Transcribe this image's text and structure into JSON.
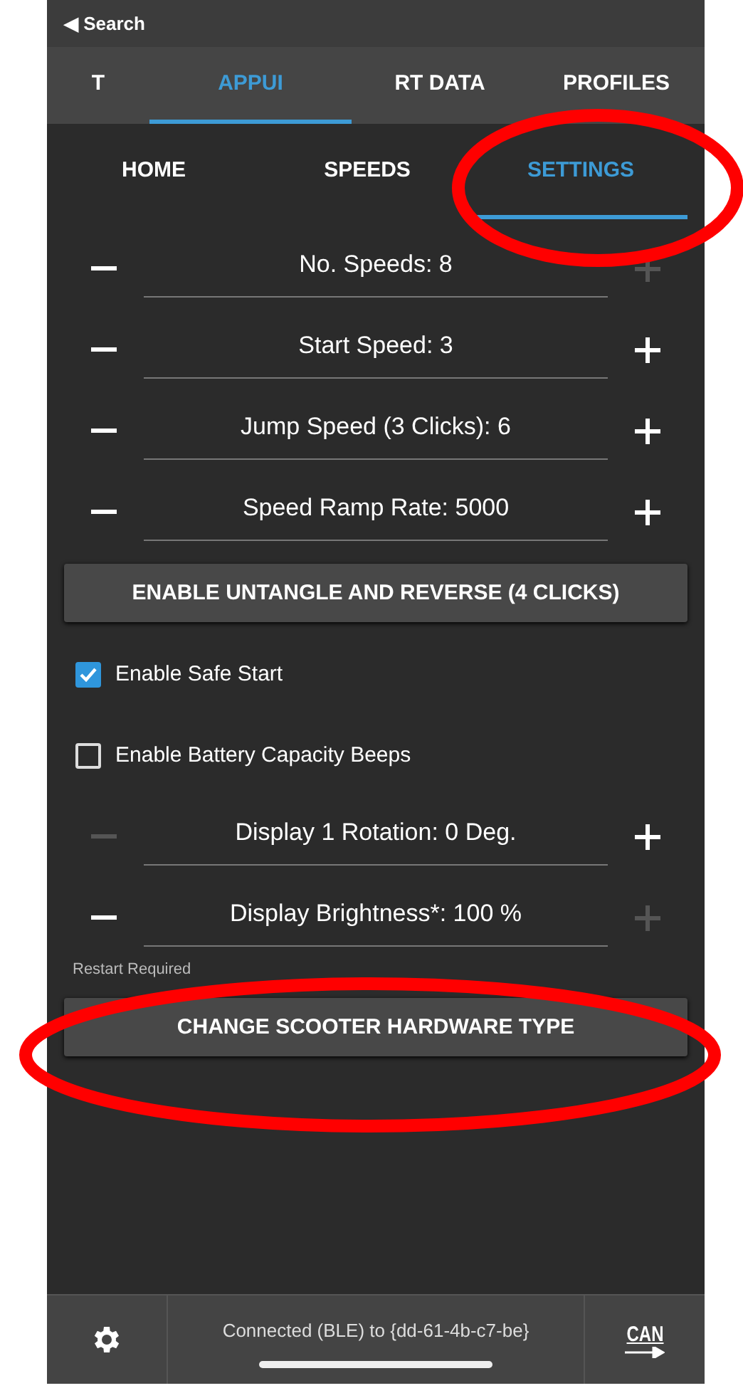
{
  "status_bar": {
    "back": "◀ Search"
  },
  "tabs": [
    {
      "label": "T",
      "selected": false
    },
    {
      "label": "APPUI",
      "selected": true
    },
    {
      "label": "RT DATA",
      "selected": false
    },
    {
      "label": "PROFILES",
      "selected": false
    }
  ],
  "subtabs": [
    {
      "label": "HOME",
      "selected": false
    },
    {
      "label": "SPEEDS",
      "selected": false
    },
    {
      "label": "SETTINGS",
      "selected": true
    }
  ],
  "settings": [
    {
      "kind": "stepper",
      "label": "No. Speeds: 8",
      "minus_disabled": false,
      "plus_disabled": true
    },
    {
      "kind": "stepper",
      "label": "Start Speed: 3",
      "minus_disabled": false,
      "plus_disabled": false
    },
    {
      "kind": "stepper",
      "label": "Jump Speed (3 Clicks): 6",
      "minus_disabled": false,
      "plus_disabled": false
    },
    {
      "kind": "stepper",
      "label": "Speed Ramp Rate: 5000",
      "minus_disabled": false,
      "plus_disabled": false
    },
    {
      "kind": "button",
      "label": "ENABLE UNTANGLE AND REVERSE (4 CLICKS)"
    },
    {
      "kind": "checkbox",
      "label": "Enable Safe Start",
      "checked": true
    },
    {
      "kind": "checkbox",
      "label": "Enable Battery Capacity Beeps",
      "checked": false
    },
    {
      "kind": "stepper",
      "label": "Display 1 Rotation: 0 Deg.",
      "minus_disabled": true,
      "plus_disabled": false
    },
    {
      "kind": "stepper",
      "label": "Display Brightness*: 100 %",
      "minus_disabled": false,
      "plus_disabled": true
    },
    {
      "kind": "note",
      "label": "Restart Required"
    },
    {
      "kind": "button",
      "label": "CHANGE SCOOTER HARDWARE TYPE"
    }
  ],
  "bottom_bar": {
    "status": "Connected (BLE) to {dd-61-4b-c7-be}",
    "can_label": "CAN"
  }
}
